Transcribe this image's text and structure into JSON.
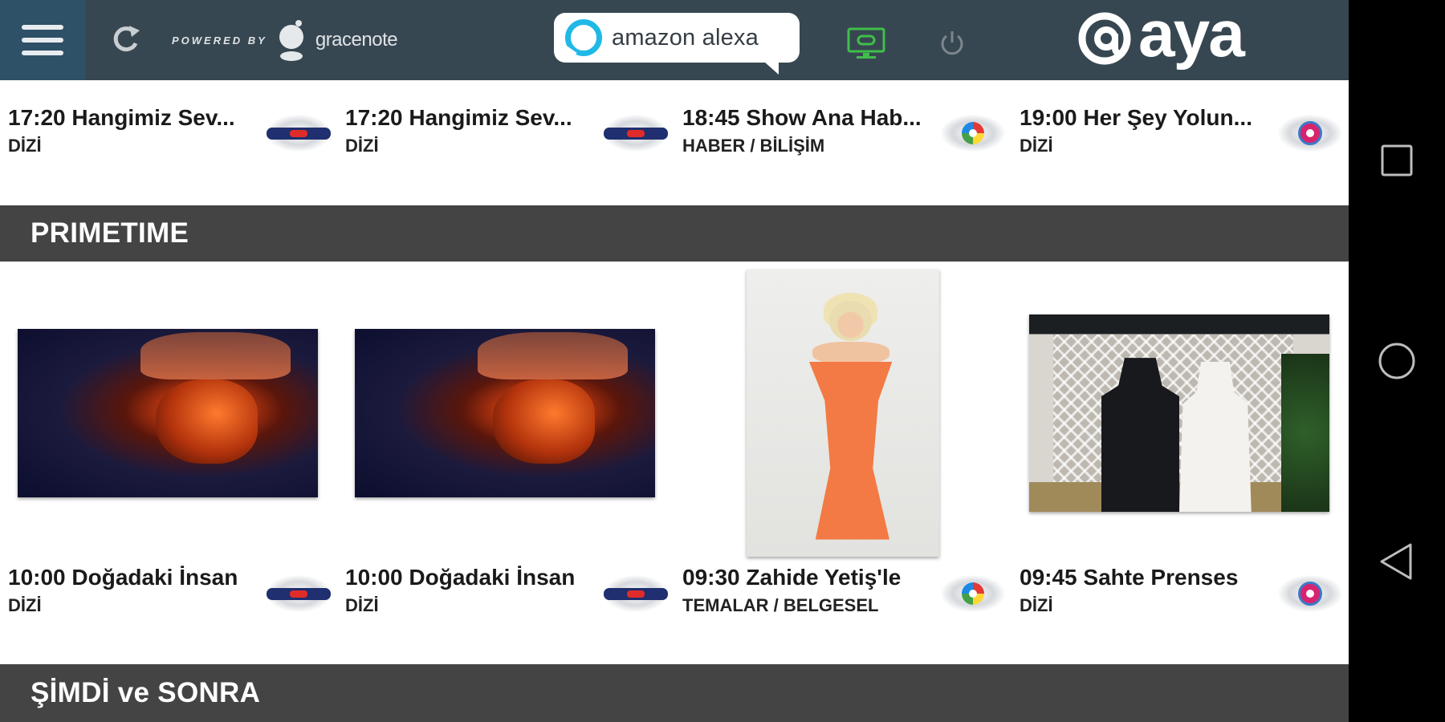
{
  "app": {
    "name": "aya"
  },
  "toolbar": {
    "powered_by": "POWERED BY",
    "gracenote_word": "gracenote",
    "alexa_label": "amazon alexa"
  },
  "colors": {
    "topbar": "#374751",
    "menu_active": "#2e5168",
    "section_header": "#444444",
    "alexa_accent": "#20b9e6",
    "tv_icon": "#3fbf4a",
    "navbar": "#000000"
  },
  "top_row": [
    {
      "title": "17:20 Hangimiz Sev...",
      "genre": "DİZİ",
      "channel_icon": "channel-logo-a"
    },
    {
      "title": "17:20 Hangimiz Sev...",
      "genre": "DİZİ",
      "channel_icon": "channel-logo-a"
    },
    {
      "title": "18:45 Show Ana Hab...",
      "genre": "HABER / BİLİŞİM",
      "channel_icon": "channel-logo-b"
    },
    {
      "title": "19:00 Her Şey Yolun...",
      "genre": "DİZİ",
      "channel_icon": "channel-logo-c"
    }
  ],
  "sections": [
    {
      "title": "PRIMETIME"
    },
    {
      "title": "ŞİMDİ ve SONRA"
    }
  ],
  "primetime": [
    {
      "title": "10:00 Doğadaki İnsan",
      "genre": "DİZİ",
      "channel_icon": "channel-logo-a",
      "thumbnail": "fire-portrait"
    },
    {
      "title": "10:00 Doğadaki İnsan",
      "genre": "DİZİ",
      "channel_icon": "channel-logo-a",
      "thumbnail": "fire-portrait"
    },
    {
      "title": "09:30 Zahide Yetiş'le",
      "genre": "TEMALAR / BELGESEL",
      "channel_icon": "channel-logo-b",
      "thumbnail": "woman-orange-dress"
    },
    {
      "title": "09:45 Sahte Prenses",
      "genre": "DİZİ",
      "channel_icon": "channel-logo-c",
      "thumbnail": "couple-portrait"
    }
  ],
  "android_nav": [
    "recents-icon",
    "home-icon",
    "back-icon"
  ]
}
